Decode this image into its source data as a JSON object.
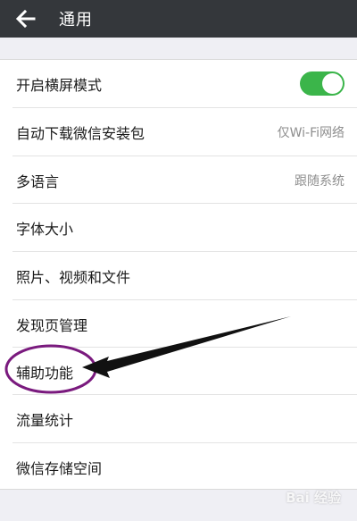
{
  "header": {
    "back_icon": "arrow-left-icon",
    "title": "通用"
  },
  "colors": {
    "toggle_on": "#3bb54a",
    "header_bg": "#34373b",
    "annotation": "#7a1a7e"
  },
  "settings": {
    "landscape": {
      "label": "开启横屏模式",
      "enabled": true
    },
    "auto_download": {
      "label": "自动下载微信安装包",
      "value": "仅Wi-Fi网络"
    },
    "language": {
      "label": "多语言",
      "value": "跟随系统"
    },
    "font_size": {
      "label": "字体大小"
    },
    "media": {
      "label": "照片、视频和文件"
    },
    "discover": {
      "label": "发现页管理"
    },
    "accessibility": {
      "label": "辅助功能"
    },
    "traffic": {
      "label": "流量统计"
    },
    "storage": {
      "label": "微信存储空间"
    }
  },
  "watermark": {
    "text": "Bai 经验"
  }
}
